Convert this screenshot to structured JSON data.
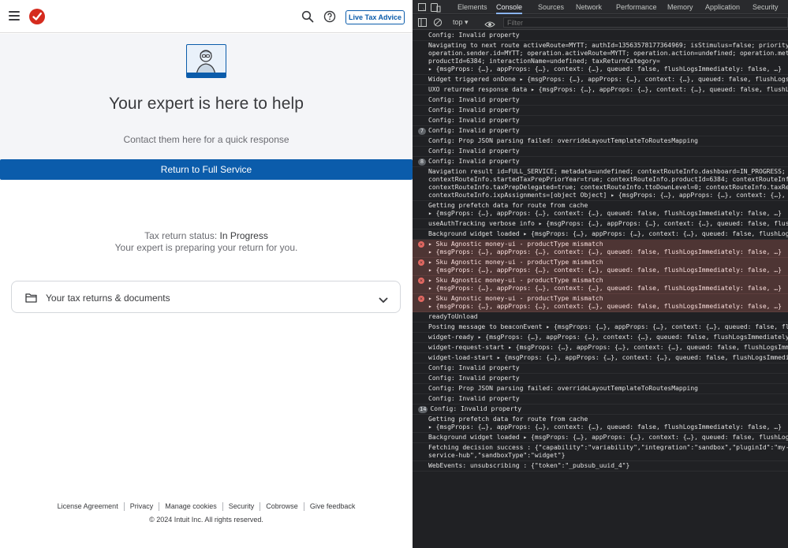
{
  "app": {
    "header": {
      "live_advice_label": "Live Tax Advice",
      "icons": [
        "menu-icon",
        "intuit-checkmark-logo",
        "search-icon",
        "help-icon"
      ]
    },
    "hero": {
      "title": "Your expert is here to help",
      "subtitle": "Contact them here for a quick response",
      "button_label": "Return to Full Service"
    },
    "status": {
      "prefix": "Tax return status: ",
      "value": "In Progress",
      "message": "Your expert is preparing your return for you."
    },
    "accordion": {
      "label": "Your tax returns & documents"
    },
    "footer": {
      "links": [
        "License Agreement",
        "Privacy",
        "Manage cookies",
        "Security",
        "Cobrowse",
        "Give feedback"
      ],
      "copyright": "© 2024 Intuit Inc. All rights reserved."
    },
    "colors": {
      "brand_blue": "#0b5cab",
      "brand_red": "#d52b1e",
      "hero_bg": "#f4f5f8"
    }
  },
  "devtools": {
    "tabs": [
      "Elements",
      "Console",
      "Sources",
      "Network",
      "Performance",
      "Memory",
      "Application",
      "Security"
    ],
    "active_tab": "Console",
    "context": "top",
    "filter_placeholder": "Filter",
    "messages": [
      {
        "text": "Config: Invalid property"
      },
      {
        "text": "Navigating to next route activeRoute=MYTT; authId=13563578177364969; isStimulus=false; priorityCa\noperation.sender.id=MYTT; operation.activeRoute=MYTT; operation.action=undefined; operation.metad\nproductId=6384; interactionName=undefined; taxReturnCategory=\n▸ {msgProps: {…}, appProps: {…}, context: {…}, queued: false, flushLogsImmediately: false, …}"
      },
      {
        "text": "Widget triggered onDone ▸ {msgProps: {…}, appProps: {…}, context: {…}, queued: false, flushLogsI"
      },
      {
        "text": "UXO returned response data ▸ {msgProps: {…}, appProps: {…}, context: {…}, queued: false, flushLo"
      },
      {
        "text": "Config: Invalid property"
      },
      {
        "text": "Config: Invalid property"
      },
      {
        "text": "Config: Invalid property"
      },
      {
        "text": "Config: Invalid property",
        "count": "7"
      },
      {
        "text": "Config: Prop JSON parsing failed: overrideLayoutTemplateToRoutesMapping"
      },
      {
        "text": "Config: Invalid property"
      },
      {
        "text": "Config: Invalid property",
        "count": "8"
      },
      {
        "text": "Navigation result id=FULL_SERVICE; metadata=undefined; contextRouteInfo.dashboard=IN_PROGRESS; co\ncontextRouteInfo.startedTaxPrepPriorYear=true; contextRouteInfo.productId=6384; contextRouteInfo\ncontextRouteInfo.taxPrepDelegated=true; contextRouteInfo.ttoDownLevel=0; contextRouteInfo.taxRet\ncontextRouteInfo.ixpAssignments=[object Object] ▸ {msgProps: {…}, appProps: {…}, context: {…}, q"
      },
      {
        "text": "Getting prefetch data for route from cache\n▸ {msgProps: {…}, appProps: {…}, context: {…}, queued: false, flushLogsImmediately: false, …}"
      },
      {
        "text": "useAuthTracking verbose info ▸ {msgProps: {…}, appProps: {…}, context: {…}, queued: false, flush"
      },
      {
        "text": "Background widget loaded ▸ {msgProps: {…}, appProps: {…}, context: {…}, queued: false, flushLogs"
      },
      {
        "text": "▸ Sku Agnostic money-ui - productType mismatch\n▸ {msgProps: {…}, appProps: {…}, context: {…}, queued: false, flushLogsImmediately: false, …}",
        "level": "error"
      },
      {
        "text": "▸ Sku Agnostic money-ui - productType mismatch\n▸ {msgProps: {…}, appProps: {…}, context: {…}, queued: false, flushLogsImmediately: false, …}",
        "level": "error"
      },
      {
        "text": "▸ Sku Agnostic money-ui - productType mismatch\n▸ {msgProps: {…}, appProps: {…}, context: {…}, queued: false, flushLogsImmediately: false, …}",
        "level": "error"
      },
      {
        "text": "▸ Sku Agnostic money-ui - productType mismatch\n▸ {msgProps: {…}, appProps: {…}, context: {…}, queued: false, flushLogsImmediately: false, …}",
        "level": "error"
      },
      {
        "text": "readyToUnload"
      },
      {
        "text": "Posting message to beaconEvent ▸ {msgProps: {…}, appProps: {…}, context: {…}, queued: false, flu"
      },
      {
        "text": "widget-ready ▸ {msgProps: {…}, appProps: {…}, context: {…}, queued: false, flushLogsImmediately:"
      },
      {
        "text": "widget-request-start ▸ {msgProps: {…}, appProps: {…}, context: {…}, queued: false, flushLogsImme"
      },
      {
        "text": "widget-load-start ▸ {msgProps: {…}, appProps: {…}, context: {…}, queued: false, flushLogsImmedia"
      },
      {
        "text": "Config: Invalid property"
      },
      {
        "text": "Config: Invalid property"
      },
      {
        "text": "Config: Prop JSON parsing failed: overrideLayoutTemplateToRoutesMapping"
      },
      {
        "text": "Config: Invalid property"
      },
      {
        "text": "Config: Invalid property",
        "count": "14"
      },
      {
        "text": "Getting prefetch data for route from cache\n▸ {msgProps: {…}, appProps: {…}, context: {…}, queued: false, flushLogsImmediately: false, …}"
      },
      {
        "text": "Background widget loaded ▸ {msgProps: {…}, appProps: {…}, context: {…}, queued: false, flushLogs"
      },
      {
        "text": "Fetching decision success : {\"capability\":\"variability\",\"integration\":\"sandbox\",\"pluginId\":\"my-e\nservice-hub\",\"sandboxType\":\"widget\"}"
      },
      {
        "text": "WebEvents: unsubscribing : {\"token\":\"_pubsub_uuid_4\"}"
      }
    ]
  }
}
